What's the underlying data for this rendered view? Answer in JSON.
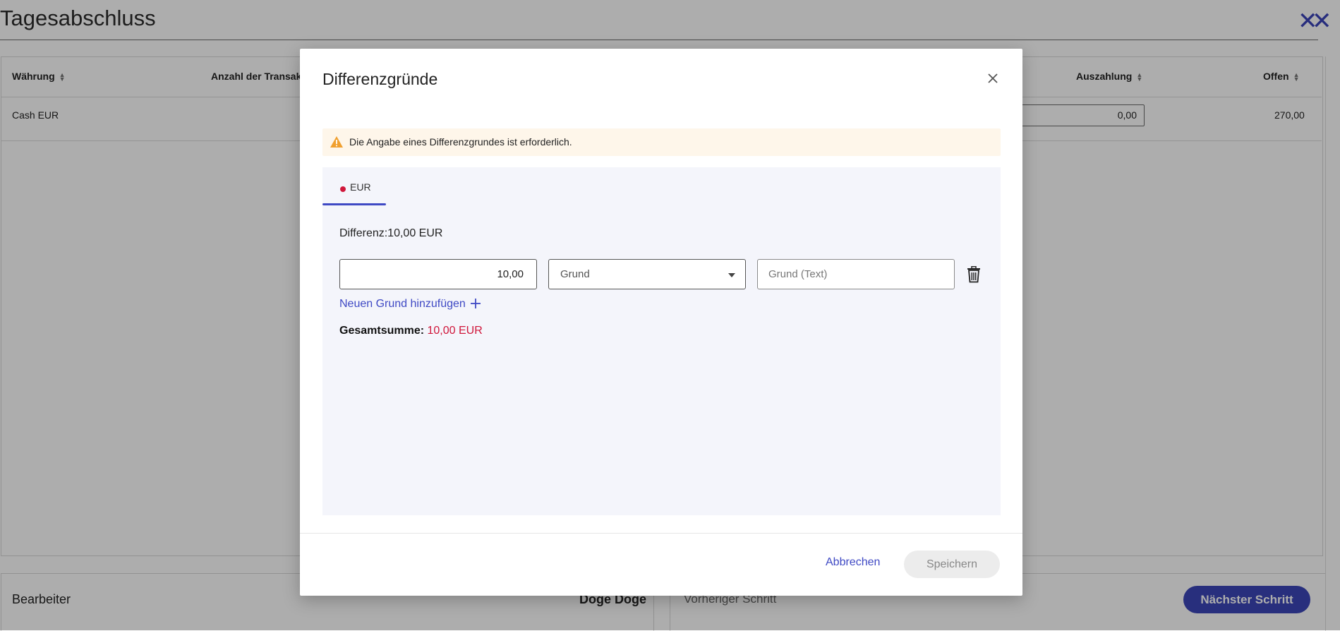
{
  "page": {
    "title": "Tagesabschluss",
    "table": {
      "headers": [
        "Währung",
        "Anzahl der Transakt",
        "Auszahlung",
        "Offen"
      ],
      "rows": [
        {
          "currency": "Cash EUR",
          "payout": "0,00",
          "open": "270,00"
        }
      ]
    },
    "bottom": {
      "editor_label": "Bearbeiter",
      "editor_name": "Doge Doge",
      "prev_step": "Vorheriger Schritt",
      "next_step": "Nächster Schritt"
    }
  },
  "modal": {
    "title": "Differenzgründe",
    "warning": "Die Angabe eines Differenzgrundes ist erforderlich.",
    "tab_label": "EUR",
    "difference_label": "Differenz:10,00 EUR",
    "amount_value": "10,00",
    "reason_select_value": "Grund",
    "reason_text_placeholder": "Grund (Text)",
    "add_reason_label": "Neuen Grund hinzufügen",
    "total_label": "Gesamtsumme:",
    "total_value": "10,00 EUR",
    "cancel_label": "Abbrechen",
    "save_label": "Speichern"
  },
  "colors": {
    "accent": "#3f49c4",
    "error": "#d0173b",
    "warning_bg": "#fef6ea",
    "warning_icon": "#f0a030"
  },
  "icons": [
    "close-icon",
    "warning-icon",
    "chevron-down-icon",
    "trash-icon",
    "plus-icon",
    "sort-icon"
  ]
}
